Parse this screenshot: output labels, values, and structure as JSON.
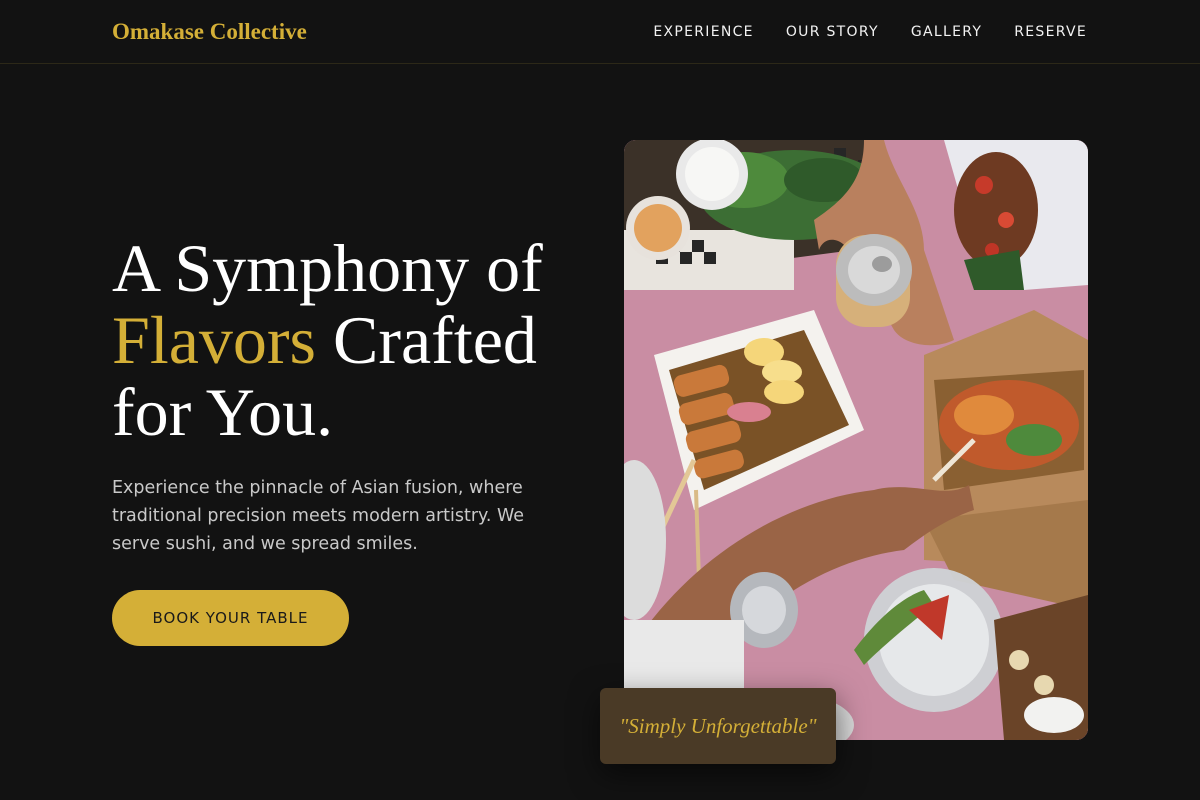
{
  "brand": {
    "name": "Omakase Collective"
  },
  "nav": {
    "items": [
      {
        "label": "EXPERIENCE"
      },
      {
        "label": "OUR STORY"
      },
      {
        "label": "GALLERY"
      },
      {
        "label": "RESERVE"
      }
    ]
  },
  "hero": {
    "headline_part1": "A Symphony of",
    "headline_highlight": "Flavors",
    "headline_part2": " Crafted",
    "headline_part3": "for You.",
    "description": "Experience the pinnacle of Asian fusion, where traditional precision meets modern artistry. We serve sushi, and we spread smiles.",
    "cta_label": "BOOK YOUR TABLE"
  },
  "badge": {
    "quote": "\"Simply Unforgettable\""
  },
  "colors": {
    "background": "#121212",
    "accent_gold": "#d4af37",
    "badge_brown": "#4a3a26",
    "text_muted": "#c9c9c9"
  }
}
